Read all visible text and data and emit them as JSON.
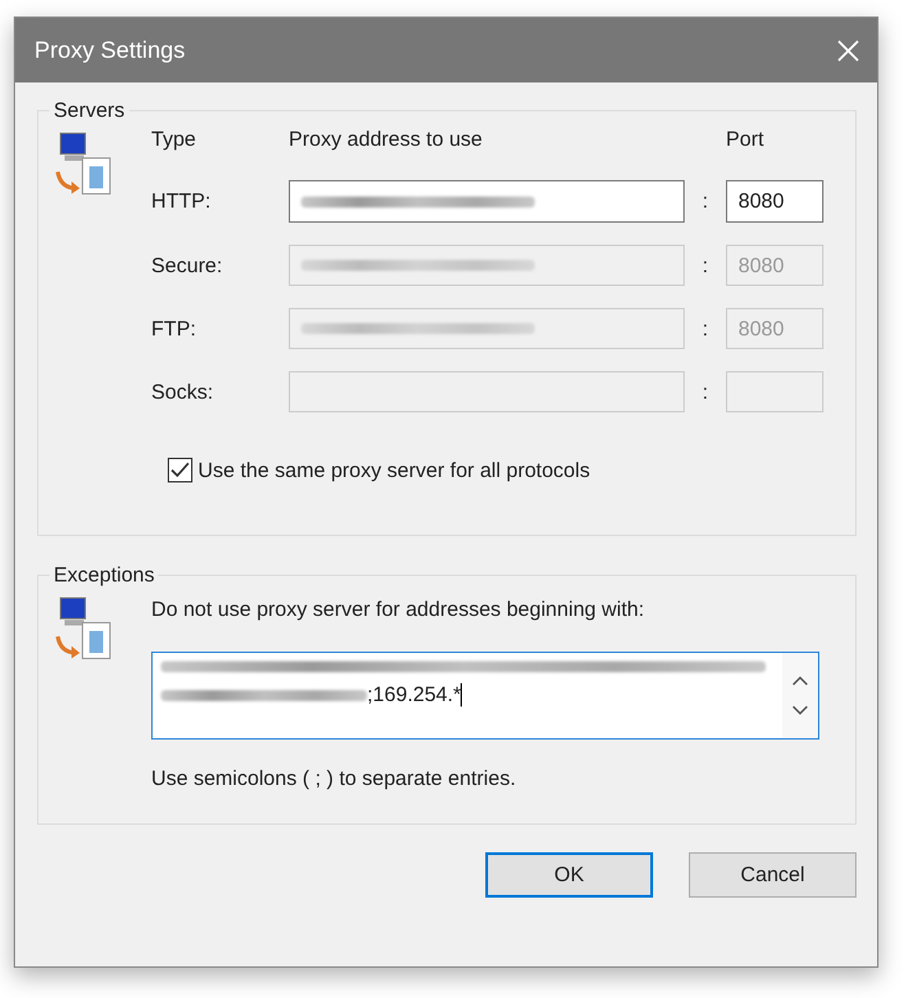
{
  "window": {
    "title": "Proxy Settings"
  },
  "servers": {
    "title": "Servers",
    "headers": {
      "type": "Type",
      "address": "Proxy address to use",
      "port": "Port"
    },
    "rows": [
      {
        "label": "HTTP:",
        "disabled": false,
        "address_redacted": true,
        "separator": ":",
        "port": "8080"
      },
      {
        "label": "Secure:",
        "disabled": true,
        "address_redacted": true,
        "separator": ":",
        "port": "8080"
      },
      {
        "label": "FTP:",
        "disabled": true,
        "address_redacted": true,
        "separator": ":",
        "port": "8080"
      },
      {
        "label": "Socks:",
        "disabled": true,
        "address_redacted": false,
        "separator": ":",
        "port": ""
      }
    ],
    "same_proxy": {
      "label": "Use the same proxy server for all protocols",
      "checked": true
    }
  },
  "exceptions": {
    "title": "Exceptions",
    "label": "Do not use proxy server for addresses beginning with:",
    "value_tail": ";169.254.*",
    "note": "Use semicolons ( ; ) to separate entries."
  },
  "buttons": [
    {
      "label": "OK",
      "default": true
    },
    {
      "label": "Cancel",
      "default": false
    }
  ]
}
